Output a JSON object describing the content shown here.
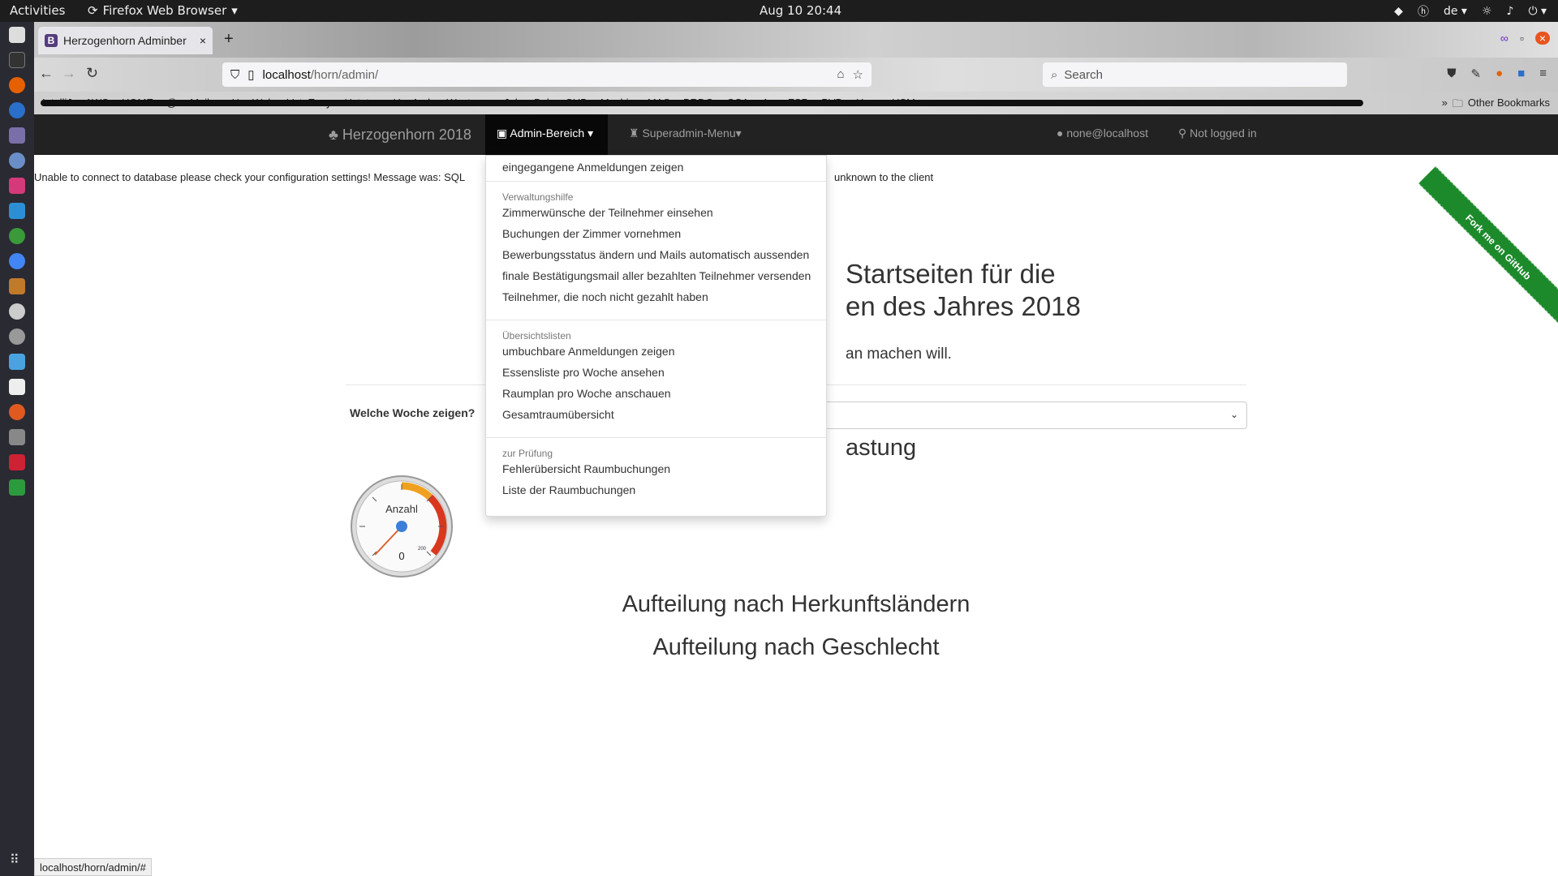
{
  "system": {
    "activities": "Activities",
    "app_name": "Firefox Web Browser",
    "clock": "Aug 10  20:44",
    "language": "de"
  },
  "browser": {
    "tab_title": "Herzogenhorn Adminber",
    "tab_favicon": "B",
    "url_host": "localhost",
    "url_path": "/horn/admin/",
    "search_placeholder": "Search",
    "bookmarks": [
      "IntelliJ",
      "AWS",
      "HOME",
      "@",
      "Mailer",
      "H",
      "Web",
      "VoteEasy",
      "Hstatus",
      "HexArch",
      "Westeam",
      "Jab",
      "Bob",
      "SUB",
      "Mushin",
      "MAS",
      "BRDG",
      "CCA",
      "An",
      "FSP",
      "PVD",
      "Horn",
      "HSM"
    ],
    "other_bookmarks": "Other Bookmarks",
    "status_url": "localhost/horn/admin/#"
  },
  "site": {
    "brand": "Herzogenhorn 2018",
    "admin_menu": "Admin-Bereich",
    "superadmin_menu": "Superadmin-Menu",
    "user": "none@localhost",
    "login_status": "Not logged in",
    "fork_ribbon": "Fork me on GitHub"
  },
  "dropdown": {
    "first_item": "eingegangene Anmeldungen zeigen",
    "sections": [
      {
        "header": "Verwaltungshilfe",
        "items": [
          "Zimmerwünsche der Teilnehmer einsehen",
          "Buchungen der Zimmer vornehmen",
          "Bewerbungsstatus ändern und Mails automatisch aussenden",
          "finale Bestätigungsmail aller bezahlten Teilnehmer versenden",
          "Teilnehmer, die noch nicht gezahlt haben"
        ]
      },
      {
        "header": "Übersichtslisten",
        "items": [
          "umbuchbare Anmeldungen zeigen",
          "Essensliste pro Woche ansehen",
          "Raumplan pro Woche anschauen",
          "Gesamtraumübersicht"
        ]
      },
      {
        "header": "zur Prüfung",
        "items": [
          "Fehlerübersicht Raumbuchungen",
          "Liste der Raumbuchungen"
        ]
      }
    ]
  },
  "main": {
    "error_prefix": "Unable to connect to database please check your configuration settings! Message was: SQL",
    "error_suffix": "unknown to the client",
    "hero_line1": "Startseiten für die",
    "hero_line2": "en des Jahres 2018",
    "hero_sub": "an machen will.",
    "week_label": "Welche Woche zeigen?",
    "auslastung": "astung",
    "gauge": {
      "label": "Anzahl",
      "value": "0",
      "max_label": "200"
    },
    "countries_heading": "Aufteilung nach Herkunftsländern",
    "gender_heading": "Aufteilung nach Geschlecht"
  },
  "colors": {
    "navbar_bg": "#222222",
    "active_tab_bg": "#080808",
    "ribbon": "#1c8a2a",
    "gauge_red": "#d9381e",
    "gauge_orange": "#f0a020",
    "gauge_needle": "#3c7fd8"
  }
}
